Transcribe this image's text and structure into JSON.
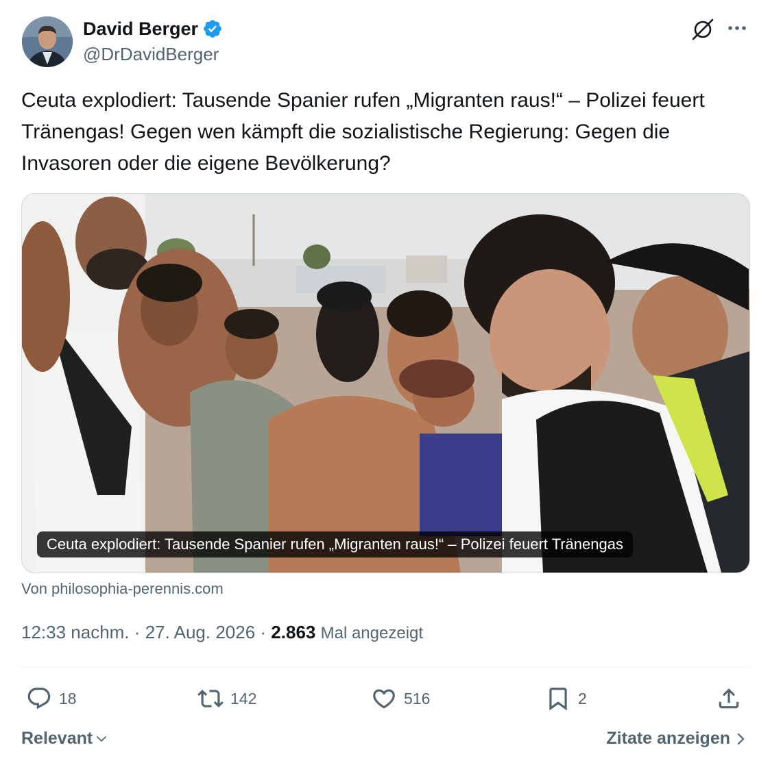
{
  "author": {
    "name": "David Berger",
    "handle": "@DrDavidBerger",
    "verified": true
  },
  "header_icons": [
    "grok-icon",
    "more-icon"
  ],
  "tweet": {
    "text": "Ceuta explodiert: Tausende Spanier rufen „Migranten raus!“ – Polizei feuert Tränengas! Gegen wen kämpft die sozialistische Regierung: Gegen die Invasoren oder die eigene Bevölkerung?"
  },
  "card": {
    "caption": "Ceuta explodiert: Tausende Spanier rufen „Migranten raus!“ – Polizei feuert Tränengas",
    "source": "Von philosophia-perennis.com"
  },
  "meta": {
    "time": "12:33 nachm.",
    "date": "27. Aug. 2026",
    "views_count": "2.863",
    "views_label": "Mal angezeigt"
  },
  "actions": {
    "replies": "18",
    "reposts": "142",
    "likes": "516",
    "bookmarks": "2"
  },
  "footer": {
    "sort_label": "Relevant",
    "quotes_label": "Zitate anzeigen"
  },
  "colors": {
    "verified": "#1d9bf0",
    "text": "#0f1419",
    "secondary": "#536471"
  }
}
